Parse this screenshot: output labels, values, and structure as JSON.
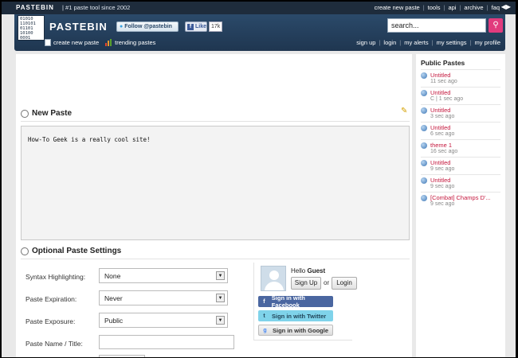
{
  "topbar": {
    "brand": "PASTEBIN",
    "tagline": "| #1 paste tool since 2002",
    "links": [
      "create new paste",
      "tools",
      "api",
      "archive",
      "faq"
    ],
    "arrows": "◀▶"
  },
  "header": {
    "logo_digits": "01010\n110101\n01101\n10100\n0001",
    "logo_text": "PASTEBIN",
    "follow_label": "Follow @pastebin",
    "like_label": "Like",
    "like_count": "17k",
    "search_value": "search...",
    "nav_left": [
      "create new paste",
      "trending pastes"
    ],
    "nav_right": [
      "sign up",
      "login",
      "my alerts",
      "my settings",
      "my profile"
    ]
  },
  "new_paste": {
    "title": "New Paste",
    "content": "How-To Geek is a really cool site!"
  },
  "settings": {
    "title": "Optional Paste Settings",
    "syntax_label": "Syntax Highlighting:",
    "syntax_value": "None",
    "expiration_label": "Paste Expiration:",
    "expiration_value": "Never",
    "exposure_label": "Paste Exposure:",
    "exposure_value": "Public",
    "name_label": "Paste Name / Title:",
    "name_value": ""
  },
  "login": {
    "hello": "Hello",
    "user": "Guest",
    "signup_label": "Sign Up",
    "or": "or",
    "login_label": "Login",
    "facebook_label": "Sign in with Facebook",
    "twitter_label": "Sign in with Twitter",
    "google_label": "Sign in with Google"
  },
  "sidebar": {
    "title": "Public Pastes",
    "items": [
      {
        "title": "Untitled",
        "meta": "11 sec ago"
      },
      {
        "title": "Untitled",
        "meta": "C | 1 sec ago"
      },
      {
        "title": "Untitled",
        "meta": "3 sec ago"
      },
      {
        "title": "Untitled",
        "meta": "6 sec ago"
      },
      {
        "title": "theme 1",
        "meta": "16 sec ago"
      },
      {
        "title": "Untitled",
        "meta": "9 sec ago"
      },
      {
        "title": "Untitled",
        "meta": "9 sec ago"
      },
      {
        "title": "[Combat] Champs D'...",
        "meta": "9 sec ago"
      }
    ]
  },
  "colors": {
    "header_bg": "#1f3650",
    "accent_pink": "#e13b7d",
    "paste_link": "#c4173d"
  }
}
